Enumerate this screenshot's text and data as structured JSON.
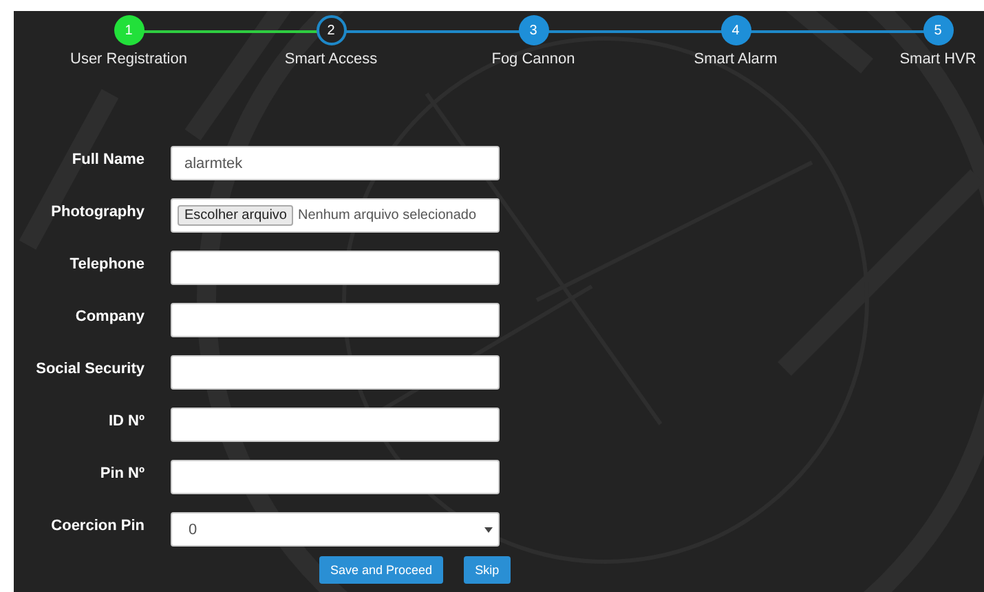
{
  "steps": [
    {
      "number": "1",
      "label": "User Registration",
      "kind": "done"
    },
    {
      "number": "2",
      "label": "Smart Access",
      "kind": "current"
    },
    {
      "number": "3",
      "label": "Fog Cannon",
      "kind": "upcoming"
    },
    {
      "number": "4",
      "label": "Smart Alarm",
      "kind": "upcoming"
    },
    {
      "number": "5",
      "label": "Smart HVR",
      "kind": "upcoming"
    }
  ],
  "form": {
    "fields": [
      {
        "label": "Full Name",
        "kind": "text",
        "value": "alarmtek"
      },
      {
        "label": "Photography",
        "kind": "file",
        "button": "Escolher arquivo",
        "status": "Nenhum arquivo selecionado"
      },
      {
        "label": "Telephone",
        "kind": "text"
      },
      {
        "label": "Company",
        "kind": "text"
      },
      {
        "label": "Social Security",
        "kind": "text"
      },
      {
        "label": "ID Nº",
        "kind": "text"
      },
      {
        "label": "Pin Nº",
        "kind": "text"
      },
      {
        "label": "Coercion Pin",
        "kind": "select",
        "value": "0"
      }
    ],
    "buttons": [
      "Save and Proceed",
      "Skip"
    ]
  }
}
